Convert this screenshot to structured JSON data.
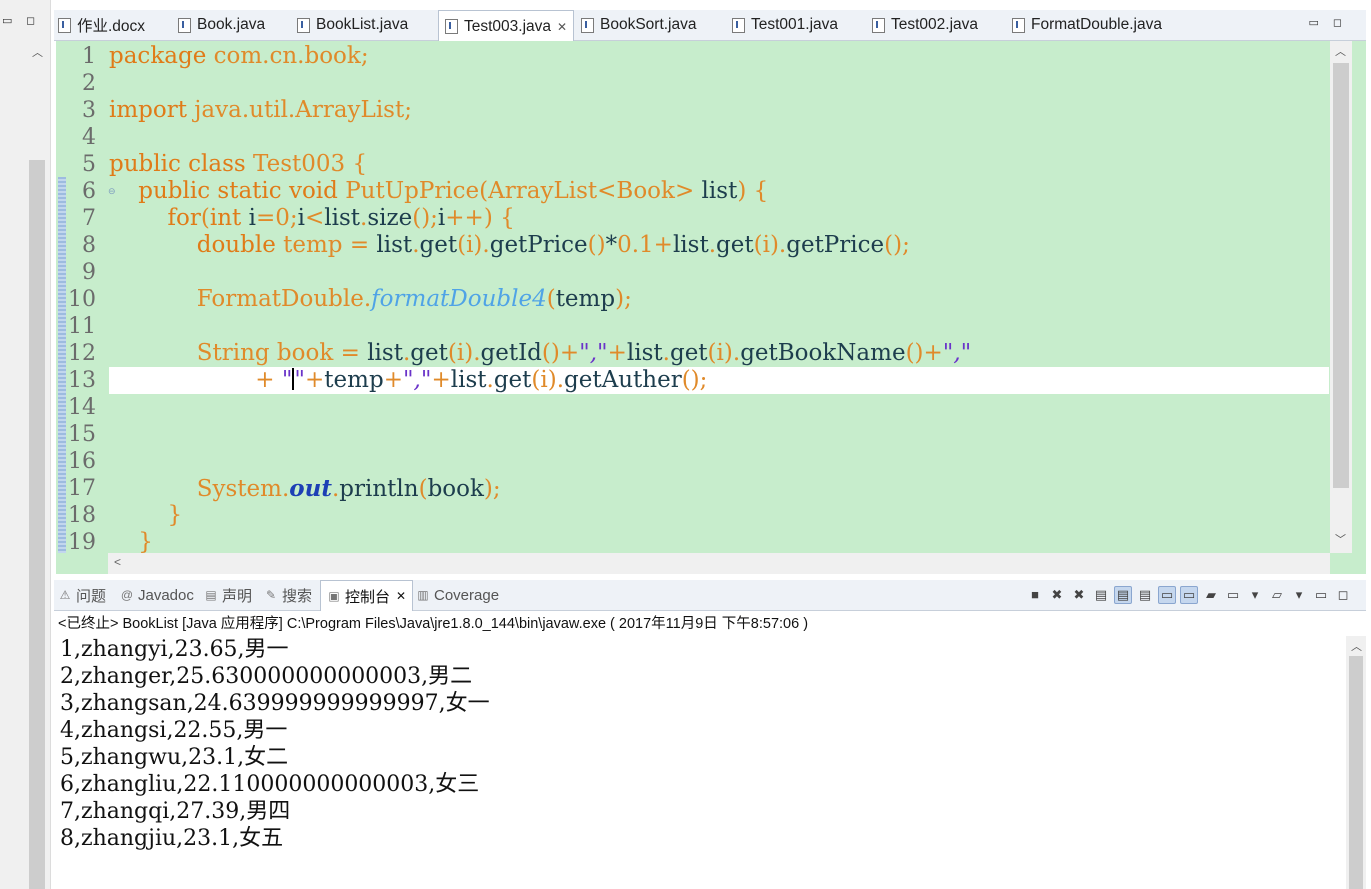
{
  "editor": {
    "tabs": [
      {
        "label": "作业.docx"
      },
      {
        "label": "Book.java"
      },
      {
        "label": "BookList.java"
      },
      {
        "label": "Test003.java",
        "active": true
      },
      {
        "label": "BookSort.java"
      },
      {
        "label": "Test001.java"
      },
      {
        "label": "Test002.java"
      },
      {
        "label": "FormatDouble.java"
      }
    ],
    "close_glyph": "✕",
    "line_numbers": [
      "1",
      "2",
      "3",
      "4",
      "5",
      "6",
      "7",
      "8",
      "9",
      "10",
      "11",
      "12",
      "13",
      "14",
      "15",
      "16",
      "17",
      "18",
      "19"
    ]
  },
  "code": {
    "l1": {
      "kw": "package",
      "rest": " com.cn.book",
      "semi": ";"
    },
    "l3": {
      "kw": "import",
      "rest": " java.util.ArrayList",
      "semi": ";"
    },
    "l5": {
      "kw": "public class",
      "name": " Test003 ",
      "brace": "{"
    },
    "l6": {
      "indent": "    ",
      "kw": "public static void",
      "name": " PutUpPrice",
      "p1": "(",
      "t1": "ArrayList",
      "lt": "<",
      "t2": "Book",
      "gt": ">",
      "arg": " list",
      "p2": ") ",
      "brace": "{"
    },
    "l7": {
      "indent": "        ",
      "kw": "for",
      "p1": "(",
      "kw2": "int",
      "a": " i",
      "eq": "=",
      "n0": "0",
      "s1": ";",
      "i": "i",
      "lt": "<",
      "lst": "list",
      "dot": ".",
      "size": "size",
      "pp": "()",
      "s2": ";",
      "ipp": "i",
      "inc": "++",
      "p2": ") ",
      "brace": "{"
    },
    "l8": {
      "indent": "            ",
      "kw": "double",
      "v": " temp ",
      "eq": "=",
      "a": " list",
      "d1": ".",
      "get": "get",
      "o1": "(",
      "i": "i",
      "c1": ")",
      "d2": ".",
      "gp": "getPrice",
      "pp": "()",
      "mul": "*",
      "n": "0.1",
      "plus": "+",
      "b": "list",
      "d3": ".",
      "get2": "get",
      "o2": "(",
      "i2": "i",
      "c2": ")",
      "d4": ".",
      "gp2": "getPrice",
      "pp2": "()",
      "semi": ";"
    },
    "l10": {
      "indent": "            ",
      "cls": "FormatDouble",
      "dot": ".",
      "m": "formatDouble4",
      "o": "(",
      "a": "temp",
      "c": ")",
      "semi": ";"
    },
    "l12": {
      "indent": "            ",
      "t": "String",
      "v": " book ",
      "eq": "=",
      "a": " list",
      "d1": ".",
      "get": "get",
      "o1": "(",
      "i": "i",
      "c1": ")",
      "d2": ".",
      "gid": "getId",
      "pp": "()",
      "plus1": "+",
      "s1": "\",\"",
      "plus2": "+",
      "b": "list",
      "d3": ".",
      "get2": "get",
      "o2": "(",
      "i2": "i",
      "c2": ")",
      "d4": ".",
      "gbn": "getBookName",
      "pp2": "()",
      "plus3": "+",
      "s2": "\",\""
    },
    "l13": {
      "indent": "                    ",
      "plus0": "+ ",
      "q1": "\"",
      "q2": "\"",
      "plus1": "+",
      "temp": "temp",
      "plus2": "+",
      "s1": "\",\"",
      "plus3": "+",
      "a": "list",
      "d1": ".",
      "get": "get",
      "o1": "(",
      "i": "i",
      "c1": ")",
      "d2": ".",
      "ga": "getAuther",
      "pp": "()",
      "semi": ";"
    },
    "l17": {
      "indent": "            ",
      "cls": "System",
      "d1": ".",
      "out": "out",
      "d2": ".",
      "m": "println",
      "o": "(",
      "a": "book",
      "c": ")",
      "semi": ";"
    },
    "l18": {
      "indent": "        ",
      "brace": "}"
    },
    "l19": {
      "indent": "    ",
      "brace": "}"
    }
  },
  "console": {
    "tabs": [
      {
        "label": "问题",
        "icon": "problems-icon"
      },
      {
        "label": "Javadoc",
        "icon": "at-icon"
      },
      {
        "label": "声明",
        "icon": "declaration-icon"
      },
      {
        "label": "搜索",
        "icon": "search-icon"
      },
      {
        "label": "控制台",
        "icon": "console-icon",
        "active": true
      },
      {
        "label": "Coverage",
        "icon": "coverage-icon"
      }
    ],
    "header": "<已终止> BookList [Java 应用程序] C:\\Program Files\\Java\\jre1.8.0_144\\bin\\javaw.exe ( 2017年11月9日 下午8:57:06 )",
    "output": [
      "1,zhangyi,23.65,男一",
      "2,zhanger,25.630000000000003,男二",
      "3,zhangsan,24.639999999999997,女一",
      "4,zhangsi,22.55,男一",
      "5,zhangwu,23.1,女二",
      "6,zhangliu,22.110000000000003,女三",
      "7,zhangqi,27.39,男四",
      "8,zhangjiu,23.1,女五"
    ]
  },
  "colors": {
    "editor_bg": "#c7edcc",
    "keyword": "#e07b18",
    "string": "#6a33c9",
    "static_method": "#4fa3e6"
  }
}
